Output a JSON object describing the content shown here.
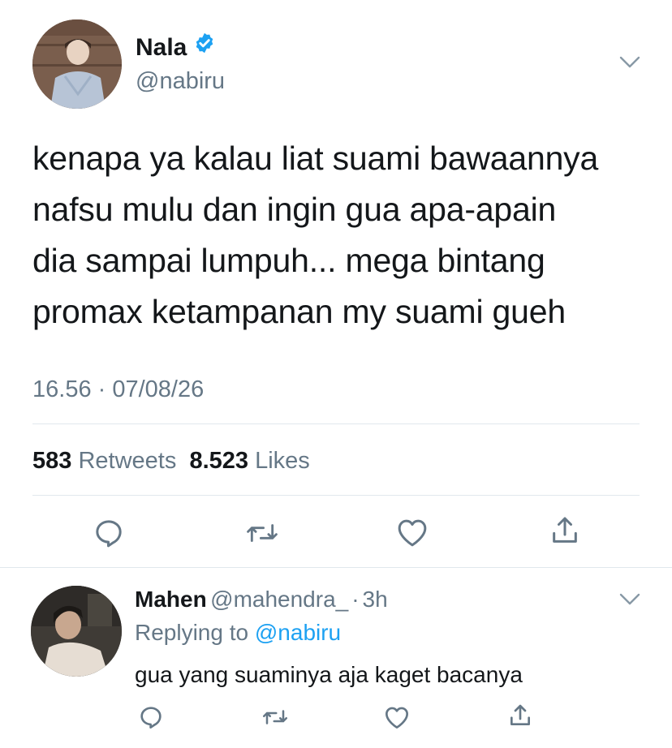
{
  "tweet": {
    "author_name": "Nala",
    "author_handle": "@nabiru",
    "verified_icon": "verified-badge-icon",
    "text": "kenapa ya kalau liat suami bawaannya\nnafsu mulu dan ingin gua apa-apain\ndia sampai lumpuh... mega bintang\npromax ketampanan my suami gueh",
    "timestamp": "16.56 · 07/08/26",
    "retweets_count": "583",
    "retweets_label": "Retweets",
    "likes_count": "8.523",
    "likes_label": "Likes",
    "actions": [
      "reply-icon",
      "retweet-icon",
      "like-icon",
      "share-icon"
    ]
  },
  "reply": {
    "author_name": "Mahen",
    "author_handle": "@mahendra_",
    "separator": "·",
    "time_ago": "3h",
    "replying_prefix": "Replying to",
    "replying_to": "@nabiru",
    "text": "gua yang suaminya aja kaget bacanya",
    "actions": [
      "reply-icon",
      "retweet-icon",
      "like-icon",
      "share-icon"
    ]
  },
  "colors": {
    "text_primary": "#14171a",
    "text_secondary": "#657786",
    "accent": "#1da1f2",
    "divider": "#e1e8ed"
  }
}
